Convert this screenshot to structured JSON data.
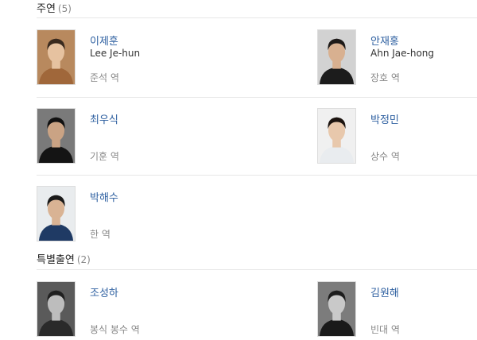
{
  "sections": [
    {
      "title": "주연",
      "count": "(5)",
      "people": [
        {
          "name": "이제훈",
          "english_name": "Lee Je-hun",
          "role": "준석 역",
          "photo": {
            "bg": "#b8895e",
            "skin": "#e6c2a0",
            "hair": "#3a2a1e",
            "clothes": "#a0673a"
          }
        },
        {
          "name": "안재홍",
          "english_name": "Ahn Jae-hong",
          "role": "장호 역",
          "photo": {
            "bg": "#d2d2d2",
            "skin": "#d8b090",
            "hair": "#1e1a18",
            "clothes": "#1c1c1c"
          }
        },
        {
          "name": "최우식",
          "english_name": "",
          "role": "기훈 역",
          "photo": {
            "bg": "#7a7a7a",
            "skin": "#caa384",
            "hair": "#111111",
            "clothes": "#141414"
          }
        },
        {
          "name": "박정민",
          "english_name": "",
          "role": "상수 역",
          "photo": {
            "bg": "#f0f0f0",
            "skin": "#e8c8ac",
            "hair": "#1c1410",
            "clothes": "#e9ecef"
          }
        },
        {
          "name": "박해수",
          "english_name": "",
          "role": "한 역",
          "photo": {
            "bg": "#e9ecee",
            "skin": "#d9b394",
            "hair": "#1a1a1a",
            "clothes": "#1f3a64"
          }
        }
      ]
    },
    {
      "title": "특별출연",
      "count": "(2)",
      "people": [
        {
          "name": "조성하",
          "english_name": "",
          "role": "봉식 봉수 역",
          "photo": {
            "bg": "#5a5a5a",
            "skin": "#bdbdbd",
            "hair": "#202020",
            "clothes": "#2a2a2a"
          }
        },
        {
          "name": "김원해",
          "english_name": "",
          "role": "빈대 역",
          "photo": {
            "bg": "#7c7c7c",
            "skin": "#c9c9c9",
            "hair": "#1d1d1d",
            "clothes": "#1a1a1a"
          }
        }
      ]
    }
  ]
}
